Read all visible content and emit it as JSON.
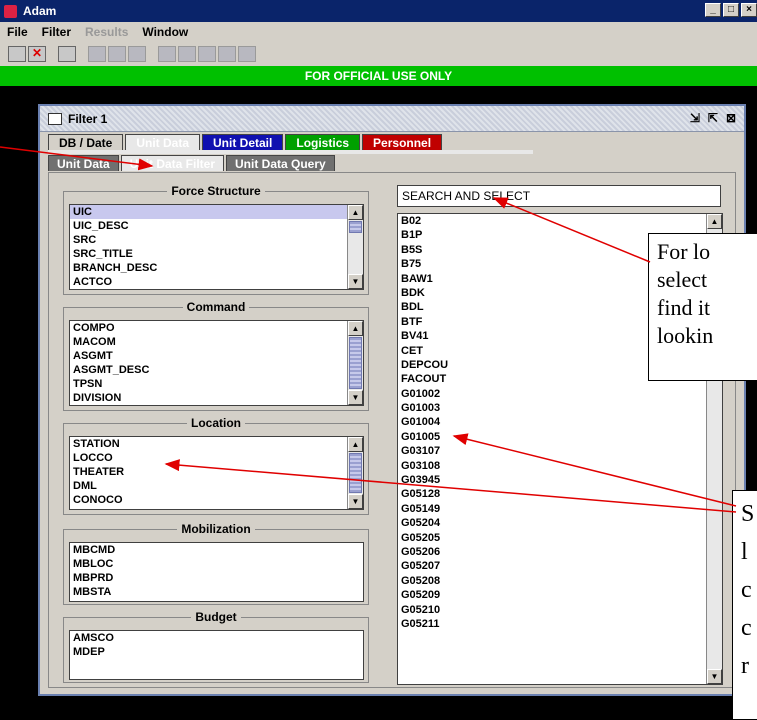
{
  "window": {
    "title": "Adam",
    "controls": [
      "_",
      "□",
      "×"
    ]
  },
  "menu": [
    "File",
    "Filter",
    "Results",
    "Window"
  ],
  "banner": "FOR OFFICIAL USE ONLY",
  "filter_window": {
    "title": "Filter 1"
  },
  "tabs": [
    "DB / Date",
    "Unit Data",
    "Unit Detail",
    "Logistics",
    "Personnel"
  ],
  "subtabs": [
    "Unit Data",
    "Unit Data Filter",
    "Unit Data Query"
  ],
  "groups": {
    "force_structure": {
      "title": "Force Structure",
      "items": [
        "UIC",
        "UIC_DESC",
        "SRC",
        "SRC_TITLE",
        "BRANCH_DESC",
        "ACTCO"
      ]
    },
    "command": {
      "title": "Command",
      "items": [
        "COMPO",
        "MACOM",
        "ASGMT",
        "ASGMT_DESC",
        "TPSN",
        "DIVISION"
      ]
    },
    "location": {
      "title": "Location",
      "items": [
        "STATION",
        "LOCCO",
        "THEATER",
        "DML",
        "CONOCO"
      ]
    },
    "mobilization": {
      "title": "Mobilization",
      "items": [
        "MBCMD",
        "MBLOC",
        "MBPRD",
        "MBSTA"
      ]
    },
    "budget": {
      "title": "Budget",
      "items": [
        "AMSCO",
        "MDEP"
      ]
    }
  },
  "search": {
    "value": "SEARCH AND SELECT"
  },
  "results": [
    "B02",
    "B1P",
    "B5S",
    "B75",
    "BAW1",
    "BDK",
    "BDL",
    "BTF",
    "BV41",
    "CET",
    "DEPCOU",
    "FACOUT",
    "G01002",
    "G01003",
    "G01004",
    "G01005",
    "G03107",
    "G03108",
    "G03945",
    "G05128",
    "G05149",
    "G05204",
    "G05205",
    "G05206",
    "G05207",
    "G05208",
    "G05209",
    "G05210",
    "G05211"
  ],
  "callouts": {
    "top": [
      "For lo",
      "select",
      "find it",
      "lookin"
    ],
    "bottom": [
      "S",
      "l",
      "c",
      "c",
      "r"
    ]
  }
}
